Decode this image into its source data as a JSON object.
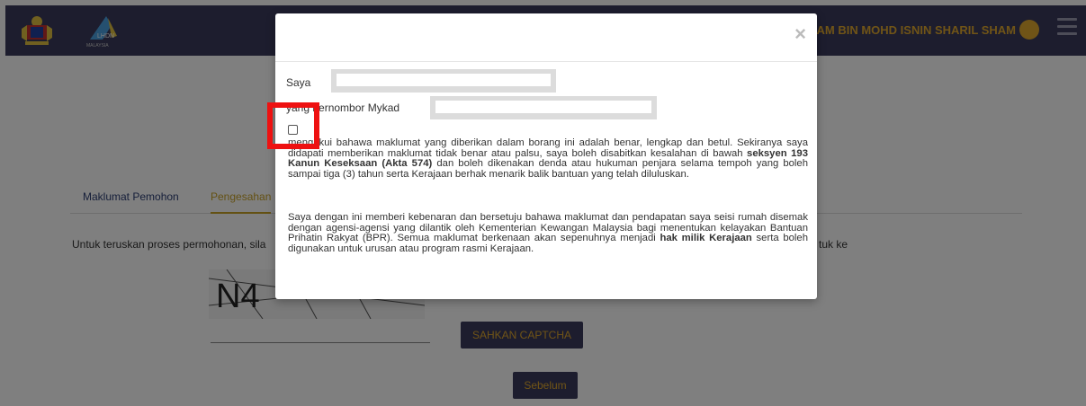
{
  "header": {
    "user_name": "ZAM BIN MOHD ISNIN SHARIL SHAM",
    "logo_text": "LHDN",
    "logo_subtext": "MALAYSIA"
  },
  "tabs": [
    {
      "label": "Maklumat Pemohon",
      "active": false
    },
    {
      "label": "Pengesahan",
      "active": true
    }
  ],
  "page": {
    "instruction_left": "Untuk teruskan proses permohonan, sila",
    "instruction_right": "tuk ke",
    "captcha_text": "N4",
    "sahkan_label": "SAHKAN CAPTCHA",
    "sebelum_label": "Sebelum"
  },
  "modal": {
    "close_symbol": "×",
    "saya_label": "Saya",
    "mykad_label": "yang bernombor Mykad",
    "para1_a": "mengakui bahawa maklumat yang diberikan dalam borang ini adalah benar, lengkap dan betul. Sekiranya saya didapati memberikan maklumat tidak benar atau palsu, saya boleh disabitkan kesalahan di bawah ",
    "para1_b": "seksyen 193 Kanun Keseksaan (Akta 574)",
    "para1_c": " dan boleh dikenakan denda atau hukuman penjara selama tempoh yang boleh sampai tiga (3) tahun serta Kerajaan berhak menarik balik bantuan yang telah diluluskan.",
    "para2_a": "Saya dengan ini memberi kebenaran dan bersetuju bahawa maklumat dan pendapatan saya seisi rumah disemak dengan agensi-agensi yang dilantik oleh Kementerian Kewangan Malaysia bagi menentukan kelayakan Bantuan Prihatin Rakyat (BPR). Semua maklumat berkenaan akan sepenuhnya menjadi ",
    "para2_b": "hak milik Kerajaan",
    "para2_c": " serta boleh digunakan untuk urusan atau program rasmi Kerajaan."
  },
  "colors": {
    "brand": "#3b3b5c",
    "accent": "#e0a82e",
    "highlight": "#ee1111"
  }
}
